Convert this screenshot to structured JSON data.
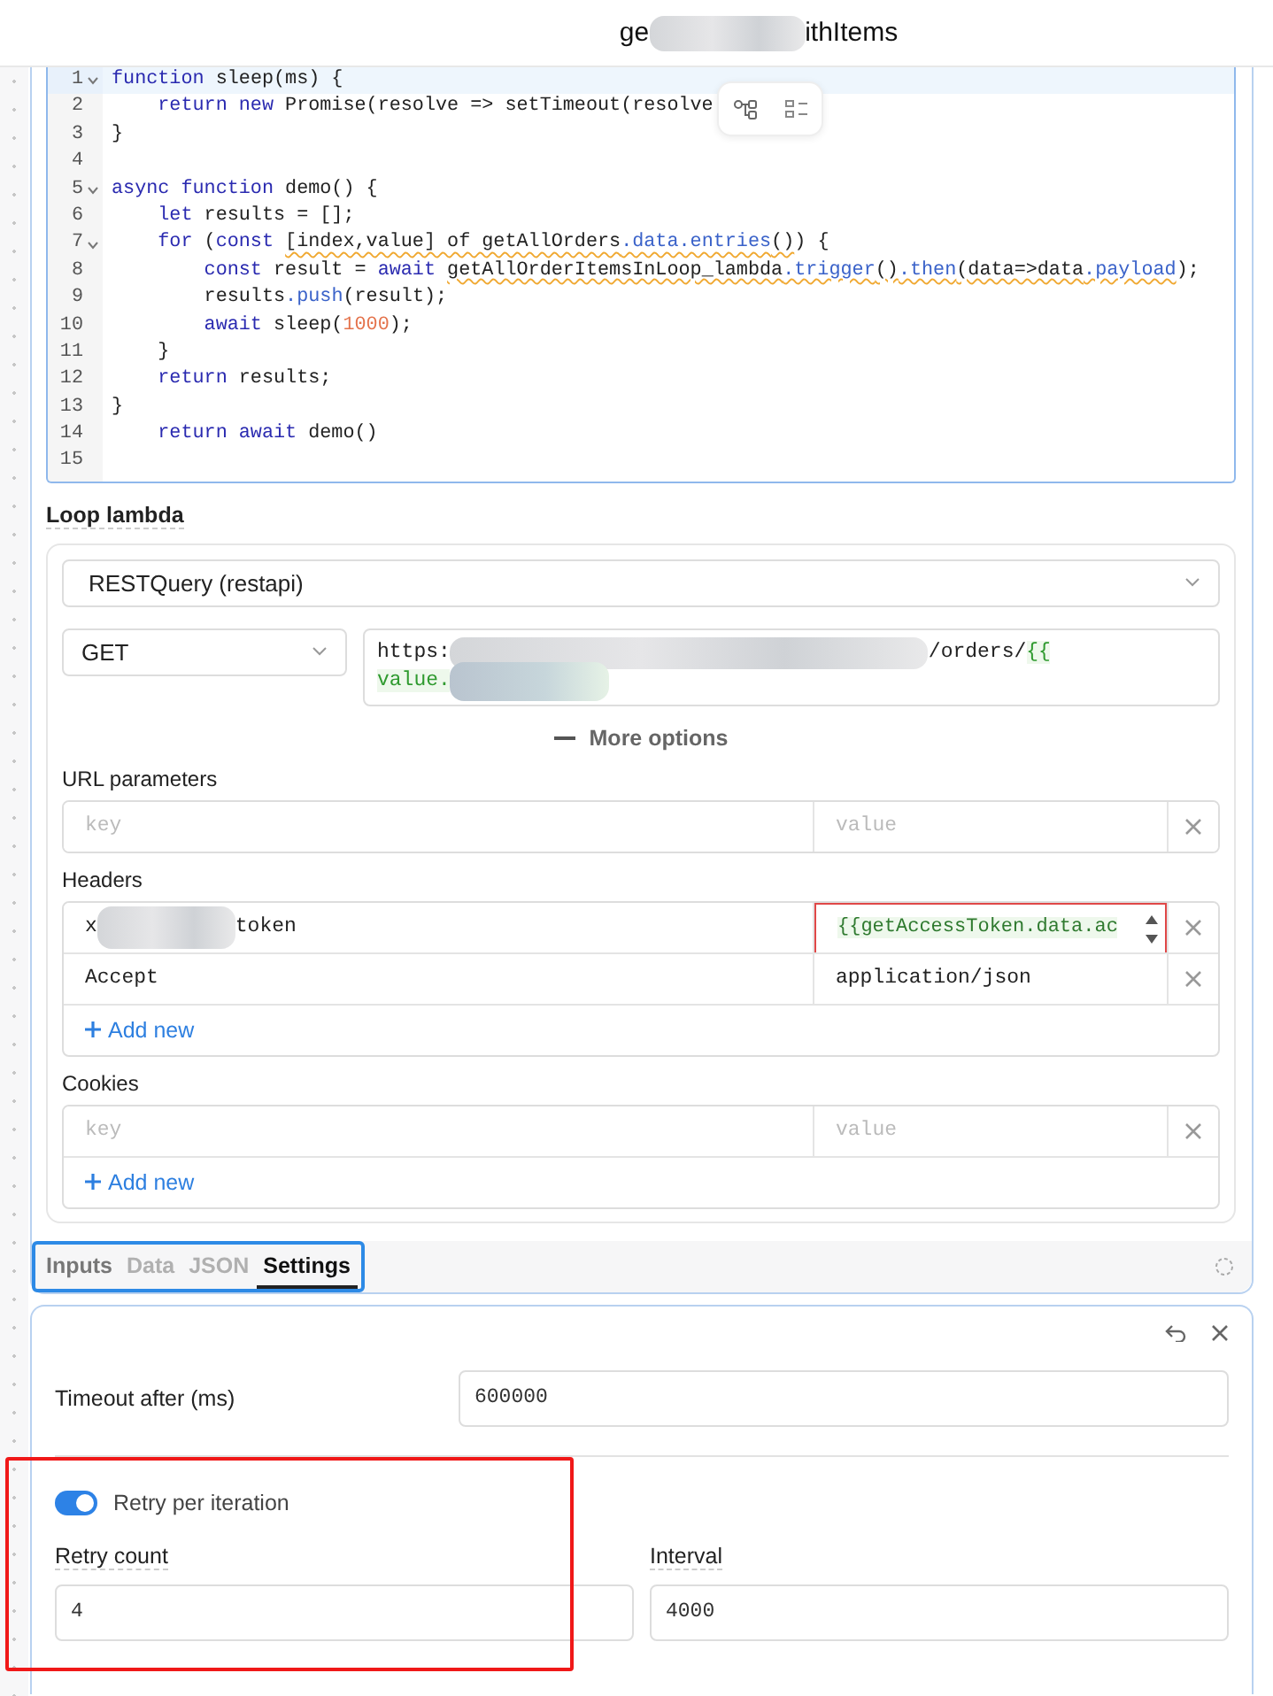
{
  "title": {
    "start": "ge",
    "end": "ithItems"
  },
  "editor": {
    "lines": [
      {
        "number": "1",
        "foldable": true,
        "current": true,
        "segments": [
          {
            "kind": "keyword",
            "text": "function"
          },
          {
            "kind": "text",
            "text": " sleep(ms) {"
          }
        ]
      },
      {
        "number": "2",
        "foldable": false,
        "current": false,
        "segments": [
          {
            "kind": "keyword",
            "text": "    return new"
          },
          {
            "kind": "text",
            "text": " Promise(resolve => setTimeout(resolve"
          }
        ]
      },
      {
        "number": "3",
        "foldable": false,
        "current": false,
        "segments": [
          {
            "kind": "text",
            "text": "}"
          }
        ]
      },
      {
        "number": "4",
        "foldable": false,
        "current": false
      },
      {
        "number": "5",
        "foldable": true,
        "current": false,
        "segments": [
          {
            "kind": "keyword",
            "text": "async function"
          },
          {
            "kind": "text",
            "text": " demo() {"
          }
        ]
      },
      {
        "number": "6",
        "foldable": false,
        "current": false,
        "segments": [
          {
            "kind": "keyword",
            "text": "    let"
          },
          {
            "kind": "text",
            "text": " results = [];"
          }
        ]
      },
      {
        "number": "7",
        "foldable": true,
        "current": false,
        "segments": [
          {
            "kind": "keyword",
            "text": "    for"
          },
          {
            "kind": "text",
            "text": " ("
          },
          {
            "kind": "keyword",
            "text": "const "
          },
          {
            "kind": "flagged-text",
            "text": "[index,value] of getAllOrders"
          },
          {
            "kind": "flagged-property",
            "text": ".data.entries"
          },
          {
            "kind": "flagged-text",
            "text": "()"
          },
          {
            "kind": "text",
            "text": ") {"
          }
        ]
      },
      {
        "number": "8",
        "foldable": false,
        "current": false,
        "segments": [
          {
            "kind": "keyword",
            "text": "        const"
          },
          {
            "kind": "text",
            "text": " result = "
          },
          {
            "kind": "keyword",
            "text": "await "
          },
          {
            "kind": "flagged-text",
            "text": "getAllOrderItemsInLoop_lambda"
          },
          {
            "kind": "flagged-property",
            "text": ".trigger"
          },
          {
            "kind": "flagged-text",
            "text": "()"
          },
          {
            "kind": "flagged-property",
            "text": ".then"
          },
          {
            "kind": "flagged-text",
            "text": "(data=>data"
          },
          {
            "kind": "flagged-property",
            "text": ".payload"
          },
          {
            "kind": "text",
            "text": ");"
          }
        ]
      },
      {
        "number": "9",
        "foldable": false,
        "current": false,
        "segments": [
          {
            "kind": "text",
            "text": "        results"
          },
          {
            "kind": "property",
            "text": ".push"
          },
          {
            "kind": "text",
            "text": "(result);"
          }
        ]
      },
      {
        "number": "10",
        "foldable": false,
        "current": false,
        "segments": [
          {
            "kind": "keyword",
            "text": "        await"
          },
          {
            "kind": "text",
            "text": " sleep("
          },
          {
            "kind": "number",
            "text": "1000"
          },
          {
            "kind": "text",
            "text": ");"
          }
        ]
      },
      {
        "number": "11",
        "foldable": false,
        "current": false,
        "segments": [
          {
            "kind": "text",
            "text": "    }"
          }
        ]
      },
      {
        "number": "12",
        "foldable": false,
        "current": false,
        "segments": [
          {
            "kind": "keyword",
            "text": "    return"
          },
          {
            "kind": "text",
            "text": " results;"
          }
        ]
      },
      {
        "number": "13",
        "foldable": false,
        "current": false,
        "segments": [
          {
            "kind": "text",
            "text": "}"
          }
        ]
      },
      {
        "number": "14",
        "foldable": false,
        "current": false,
        "segments": [
          {
            "kind": "keyword",
            "text": "    return await"
          },
          {
            "kind": "text",
            "text": " demo()"
          }
        ]
      },
      {
        "number": "15",
        "foldable": false,
        "current": false
      }
    ]
  },
  "loop_lambda": {
    "label": "Loop lambda",
    "source": "RESTQuery (restapi)",
    "method": "GET",
    "url": {
      "start": "https:",
      "middle": "/orders/",
      "template": "{{",
      "line2": "value."
    },
    "more_options": "More options",
    "url_parameters": {
      "label": "URL parameters",
      "key_placeholder": "key",
      "value_placeholder": "value"
    },
    "headers": {
      "label": "Headers",
      "rows": [
        {
          "key_start": "x",
          "key_end": "token",
          "value": "{{getAccessToken.data.ac",
          "invalid": true
        },
        {
          "key_start": "Accept",
          "value": "application/json",
          "invalid": false
        }
      ],
      "add": "Add new"
    },
    "cookies": {
      "label": "Cookies",
      "key_placeholder": "key",
      "value_placeholder": "value",
      "add": "Add new"
    }
  },
  "tabs": [
    {
      "label": "Inputs",
      "selected": false
    },
    {
      "label": "Data",
      "selected": false
    },
    {
      "label": "JSON",
      "selected": false
    },
    {
      "label": "Settings",
      "selected": true
    }
  ],
  "settings": {
    "timeout": {
      "label": "Timeout after (ms)",
      "value": "600000"
    },
    "retry": {
      "label": "Retry per iteration",
      "on": true
    },
    "retry_count": {
      "label": "Retry count",
      "value": "4"
    },
    "interval": {
      "label": "Interval",
      "value": "4000"
    }
  }
}
